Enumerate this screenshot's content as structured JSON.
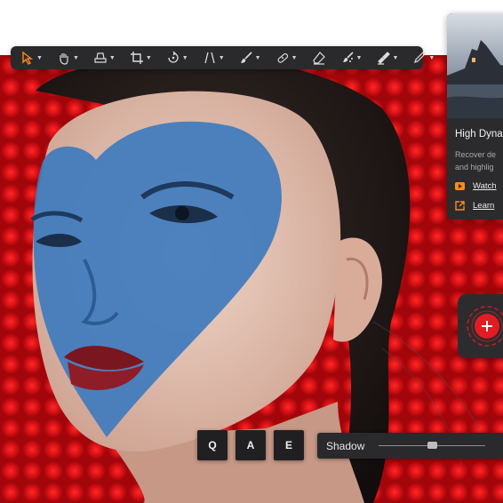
{
  "toolbar": {
    "tools": [
      {
        "icon": "select-arrow-icon",
        "active": true
      },
      {
        "icon": "hand-icon"
      },
      {
        "icon": "stamp-icon"
      },
      {
        "icon": "crop-icon"
      },
      {
        "icon": "rotate-icon"
      },
      {
        "icon": "perspective-lines-icon"
      },
      {
        "icon": "brush-icon"
      },
      {
        "icon": "bandage-icon"
      },
      {
        "icon": "eraser-icon"
      },
      {
        "icon": "clone-brush-icon"
      },
      {
        "icon": "fill-icon"
      },
      {
        "icon": "pen-icon"
      }
    ],
    "active_color": "#ff8a1c"
  },
  "panel": {
    "title": "High Dyna",
    "description_lines": [
      "Recover de",
      "and highlig"
    ],
    "links": [
      {
        "icon": "youtube-icon",
        "label": "Watch"
      },
      {
        "icon": "external-link-icon",
        "label": "Learn"
      }
    ],
    "accent_color": "#ff8a1c"
  },
  "fab": {
    "icon": "add-target-icon",
    "color": "#e31b23"
  },
  "shortcut_keys": [
    "Q",
    "A",
    "E"
  ],
  "adjustment": {
    "label": "Shadow",
    "value_fraction": 0.5
  }
}
